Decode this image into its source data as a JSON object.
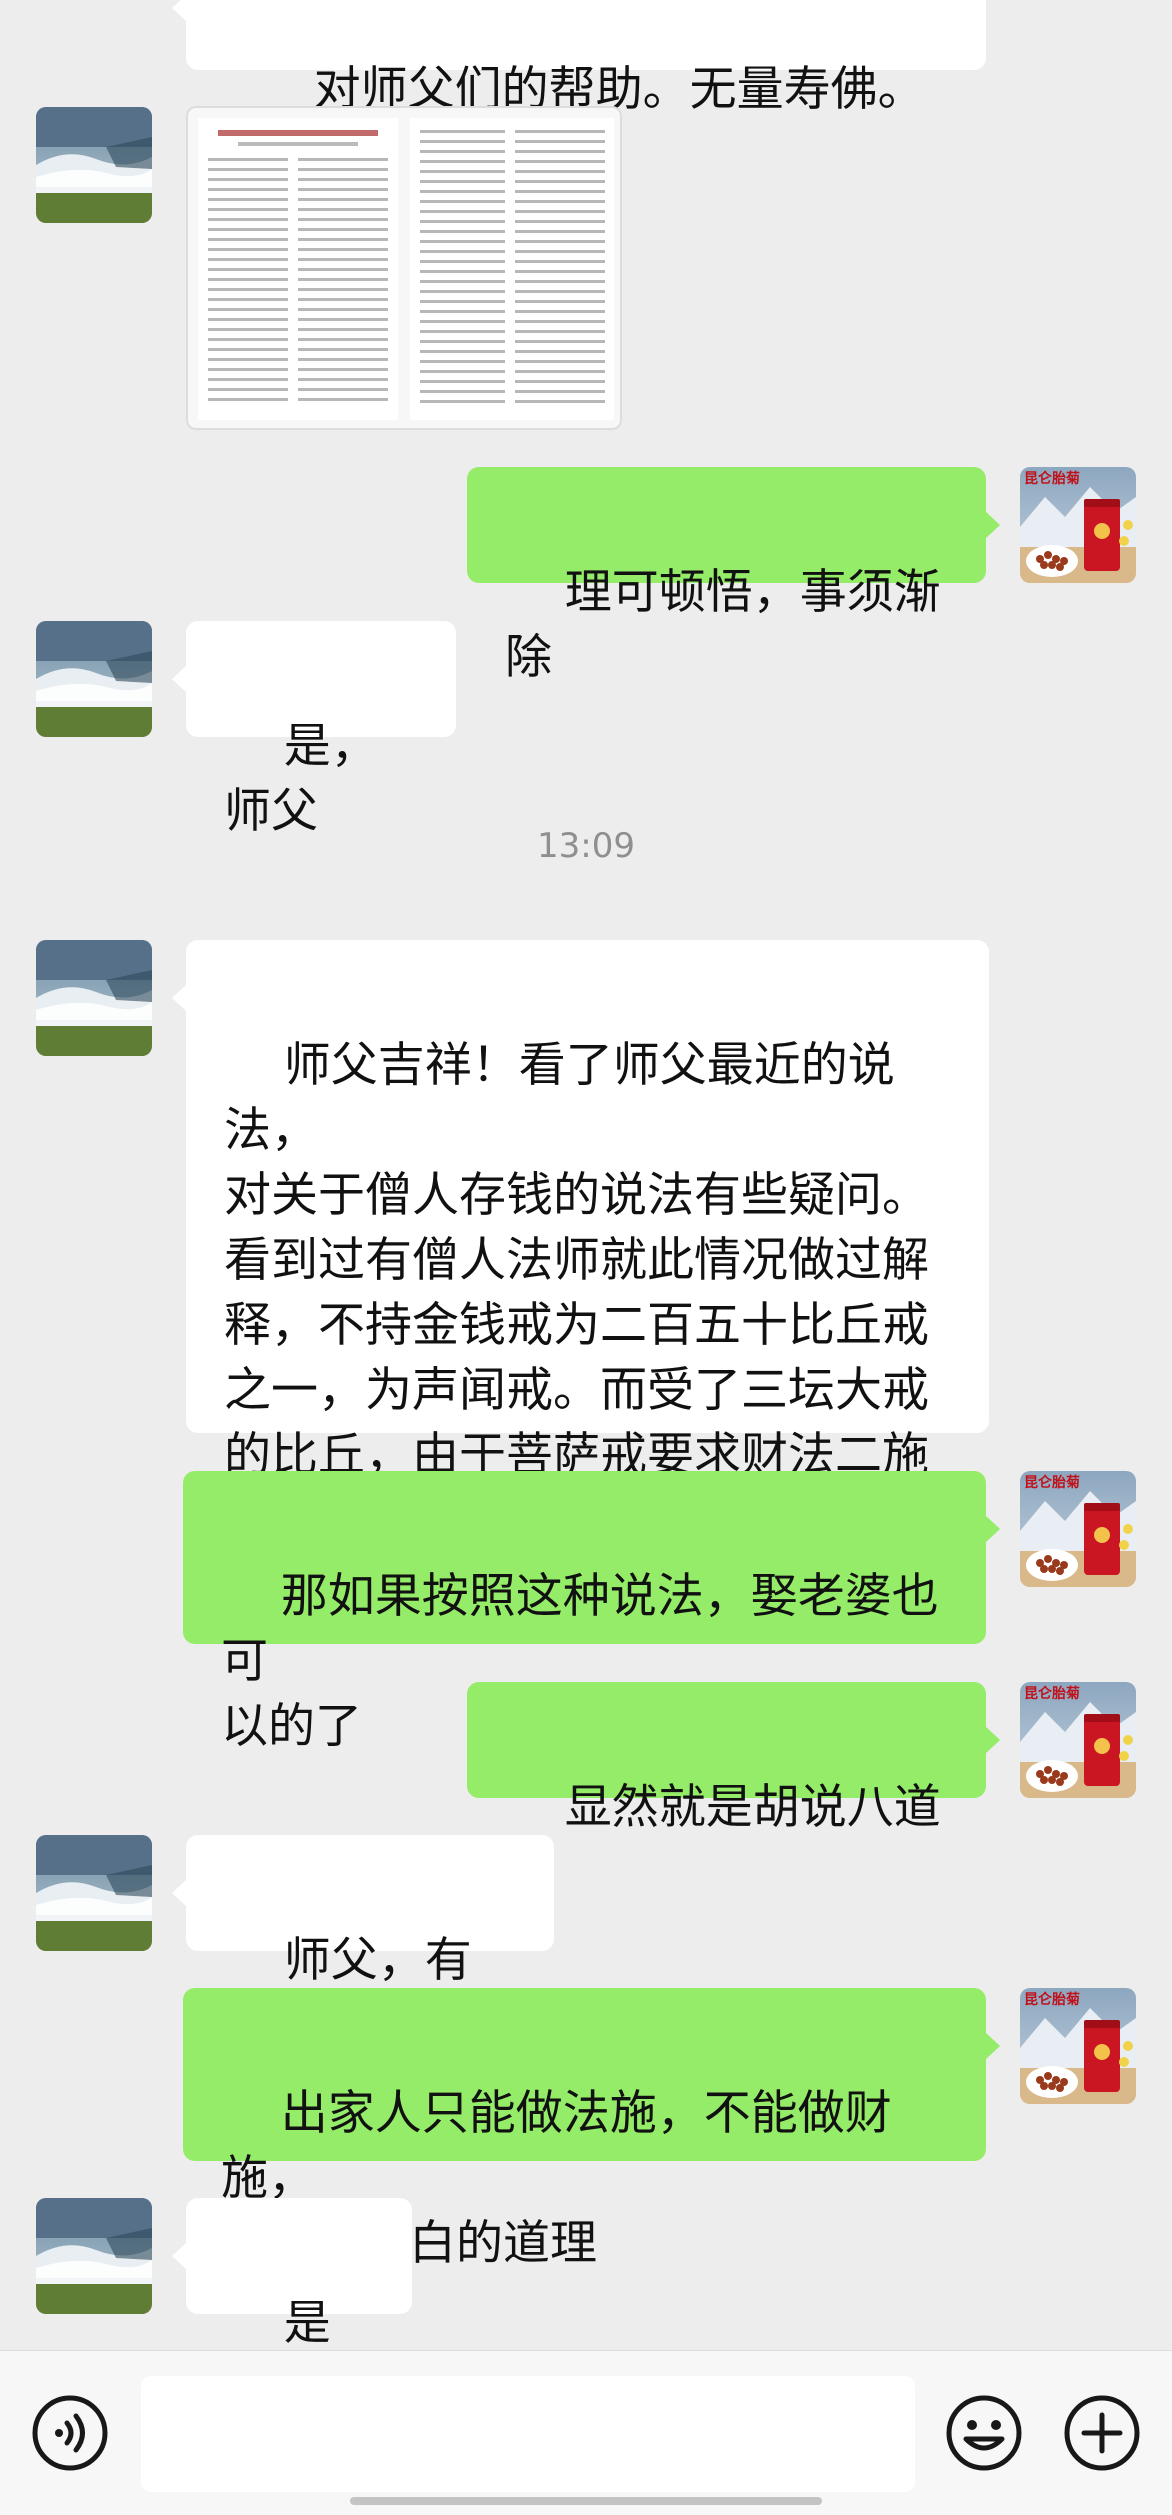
{
  "messages": [
    {
      "text": "对师父们的帮助。无量寿佛。"
    },
    {
      "text": "理可顿悟，事须渐除"
    },
    {
      "text": "是，师父"
    },
    {
      "text": "师父吉祥！看了师父最近的说法，\n对关于僧人存钱的说法有些疑问。\n看到过有僧人法师就此情况做过解\n释，不持金钱戒为二百五十比丘戒\n之一，为声闻戒。而受了三坛大戒\n的比丘，由于菩萨戒要求财法二施\n利益众生，所以存钱不犯戒。"
    },
    {
      "text": "那如果按照这种说法，娶老婆也可\n以的了"
    },
    {
      "text": "显然就是胡说八道的"
    },
    {
      "text": "师父，有道理"
    },
    {
      "text": "出家人只能做法施，不能做财施，\n这是很明白的道理"
    },
    {
      "text": "是的🙏"
    }
  ],
  "timestamp": "13:09",
  "avatar_text": "昆仑胎菊",
  "icons": {
    "voice": "voice-icon",
    "emoji": "emoji-icon",
    "plus": "plus-icon"
  },
  "colors": {
    "background": "#ededed",
    "incoming_bubble": "#ffffff",
    "outgoing_bubble": "#95ec69"
  }
}
